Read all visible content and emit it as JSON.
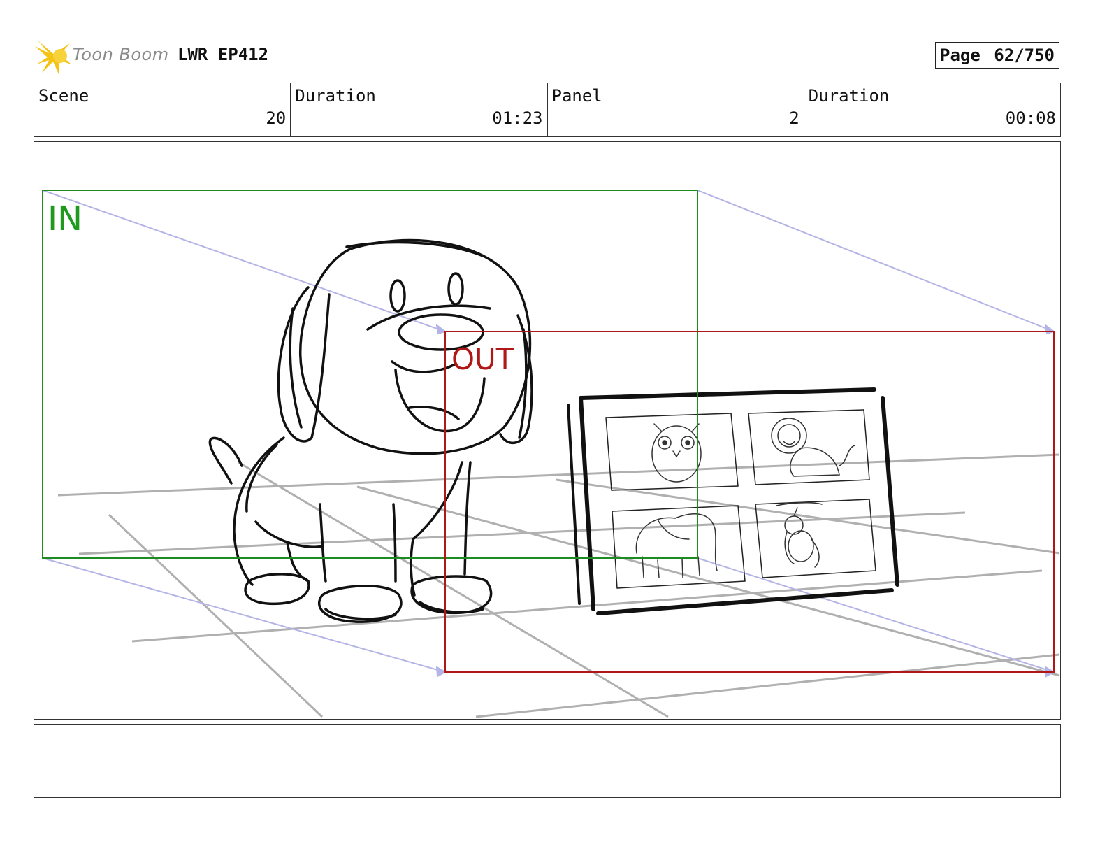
{
  "header": {
    "logo_text": "Toon Boom",
    "project": "LWR EP412",
    "page_label": "Page",
    "page_value": "62/750"
  },
  "info": {
    "scene_label": "Scene",
    "scene_value": "20",
    "scene_duration_label": "Duration",
    "scene_duration_value": "01:23",
    "panel_label": "Panel",
    "panel_value": "2",
    "panel_duration_label": "Duration",
    "panel_duration_value": "00:08"
  },
  "camera": {
    "in_label": "IN",
    "out_label": "OUT",
    "in_color": "#1f8a1f",
    "out_color": "#b01818",
    "motion_color": "#b4b4e6"
  },
  "icons": {
    "logo": "toon-boom-star-icon"
  }
}
